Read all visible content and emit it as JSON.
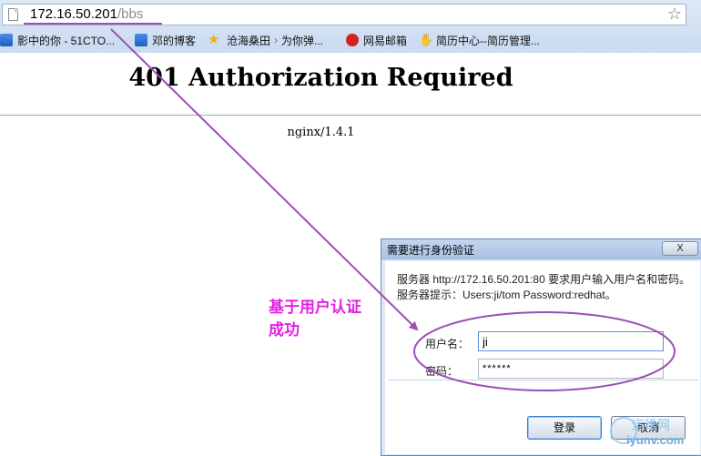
{
  "browser": {
    "url_host": "172.16.50.201",
    "url_path": "/bbs",
    "bookmarks": [
      {
        "label": "影中的你 - 51CTO..."
      },
      {
        "label": "邓的博客"
      },
      {
        "label": "沧海桑田",
        "extra": "为你弹..."
      },
      {
        "label": "网易邮箱"
      },
      {
        "label": "简历中心--简历管理..."
      }
    ]
  },
  "page": {
    "title": "401 Authorization Required",
    "server": "nginx/1.4.1"
  },
  "dialog": {
    "title": "需要进行身份验证",
    "close_label": "X",
    "message": "服务器 http://172.16.50.201:80 要求用户输入用户名和密码。服务器提示：Users:ji/tom Password:redhat。",
    "username_label": "用户名：",
    "username_value": "ji",
    "password_label": "密码：",
    "password_value": "******",
    "login_label": "登录",
    "cancel_label": "取消"
  },
  "annotation": {
    "text": "基于用户认证成功",
    "color": "#e61ee6",
    "arrow_color": "#9b4fb5"
  },
  "watermark": {
    "cn": "运维网",
    "en": "iyunv.com"
  }
}
